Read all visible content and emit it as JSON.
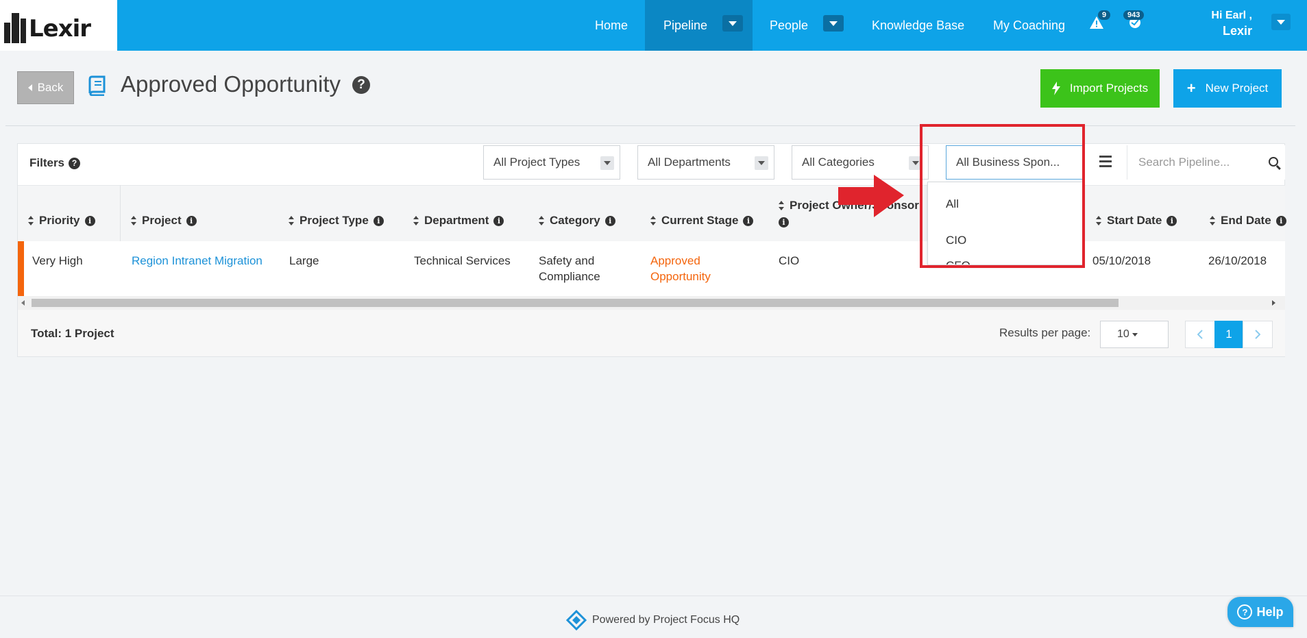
{
  "brand": {
    "name": "Lexir"
  },
  "nav": {
    "items": [
      {
        "label": "Home"
      },
      {
        "label": "Pipeline"
      },
      {
        "label": "People"
      },
      {
        "label": "Knowledge Base"
      },
      {
        "label": "My Coaching"
      }
    ],
    "alerts_count": "9",
    "notifications_count": "943",
    "greeting": "Hi Earl ,",
    "user_name": "Lexir"
  },
  "header": {
    "back_label": "Back",
    "title": "Approved Opportunity",
    "help": "?",
    "import_label": "Import Projects",
    "new_label": "New Project"
  },
  "filters": {
    "label": "Filters",
    "project_types": "All Project Types",
    "departments": "All Departments",
    "categories": "All Categories",
    "business_sponsor": "All Business Spon...",
    "search_placeholder": "Search Pipeline...",
    "sponsor_options": [
      "All",
      "CIO",
      "CFO"
    ]
  },
  "table": {
    "columns": [
      "Priority",
      "Project",
      "Project Type",
      "Department",
      "Category",
      "Current Stage",
      "Project Owner/Sponsor",
      "Start Date",
      "End Date"
    ],
    "rows": [
      {
        "priority": "Very High",
        "project": "Region Intranet Migration",
        "type": "Large",
        "department": "Technical Services",
        "category_line1": "Safety and",
        "category_line2": "Compliance",
        "stage_line1": "Approved",
        "stage_line2": "Opportunity",
        "owner": "CIO",
        "start": "05/10/2018",
        "end": "26/10/2018"
      }
    ],
    "total": "Total: 1 Project",
    "results_per_page_label": "Results per page:",
    "results_per_page": "10",
    "current_page": "1"
  },
  "footer": {
    "powered": "Powered by Project Focus HQ",
    "help_label": "Help"
  },
  "colors": {
    "nav": "#0ea3e8",
    "import": "#3cc31a",
    "accent_orange": "#f4650d",
    "highlight_red": "#e0242d"
  }
}
